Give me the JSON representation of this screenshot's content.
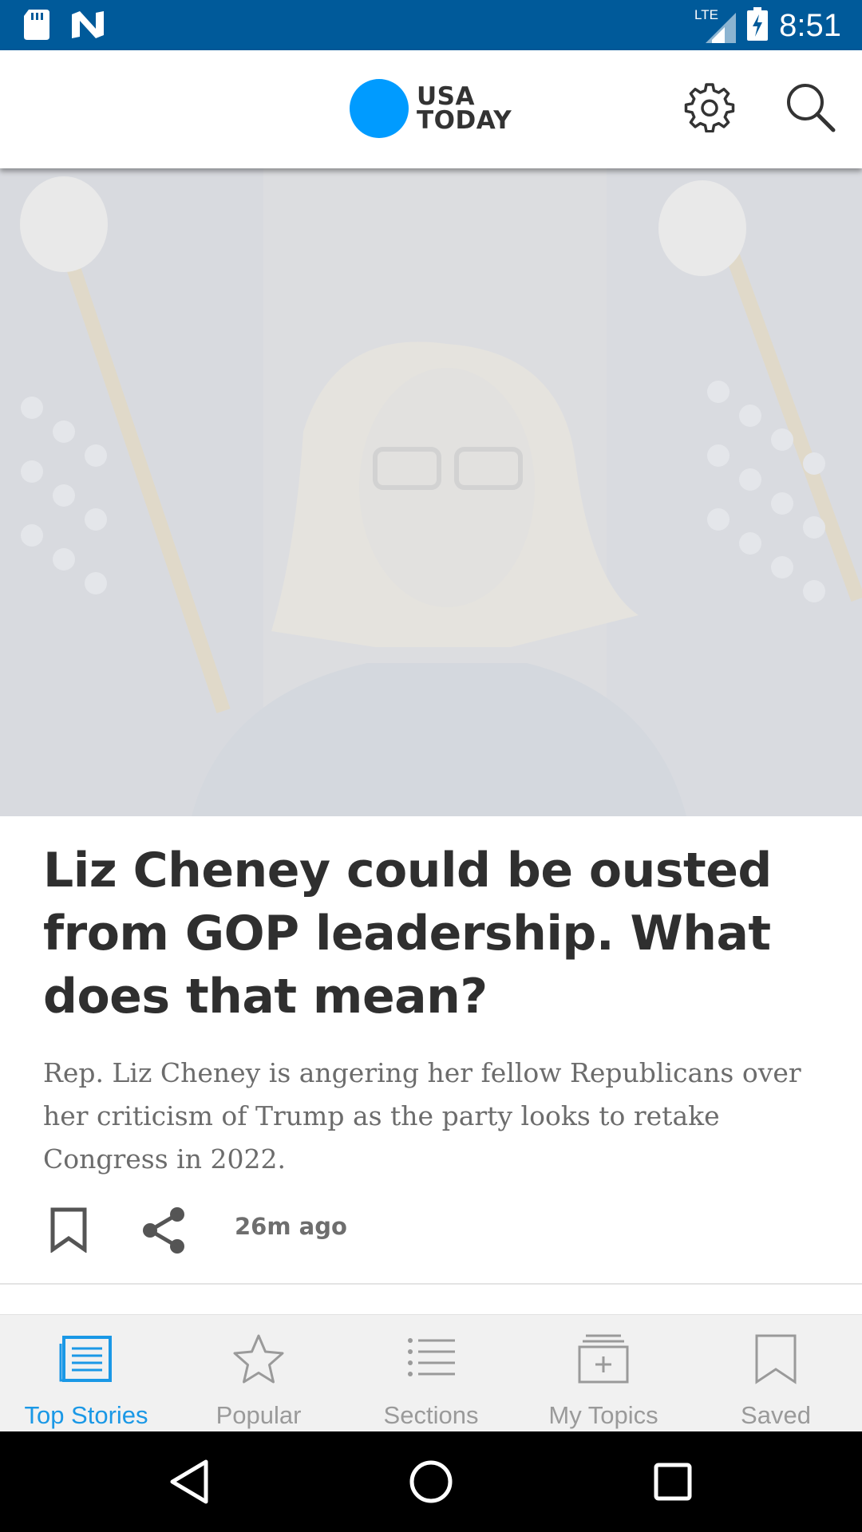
{
  "status_bar": {
    "time": "8:51",
    "network": "LTE",
    "icons": [
      "sd-card-icon",
      "n-notification-icon",
      "lte-signal-icon",
      "battery-charging-icon"
    ]
  },
  "header": {
    "logo_line1": "USA",
    "logo_line2": "TODAY",
    "logo_color": "#009bff",
    "settings_icon": "gear-icon",
    "search_icon": "search-icon"
  },
  "article": {
    "headline": "Liz Cheney could be ousted from GOP leadership. What does that mean?",
    "summary": "Rep. Liz Cheney is angering her fellow Republicans over her criticism of Trump as the party looks to retake Congress in 2022.",
    "timestamp": "26m ago",
    "bookmark_icon": "bookmark-icon",
    "share_icon": "share-icon"
  },
  "tabs": [
    {
      "label": "Top Stories",
      "icon": "news-page-icon",
      "active": true
    },
    {
      "label": "Popular",
      "icon": "star-icon",
      "active": false
    },
    {
      "label": "Sections",
      "icon": "list-icon",
      "active": false
    },
    {
      "label": "My Topics",
      "icon": "add-folder-icon",
      "active": false
    },
    {
      "label": "Saved",
      "icon": "bookmark-icon",
      "active": false
    }
  ],
  "colors": {
    "status_bar": "#005a9a",
    "accent": "#1a98e6",
    "inactive": "#9a9a9a"
  },
  "nav": {
    "back": "back-triangle-icon",
    "home": "home-circle-icon",
    "recents": "recents-square-icon"
  }
}
